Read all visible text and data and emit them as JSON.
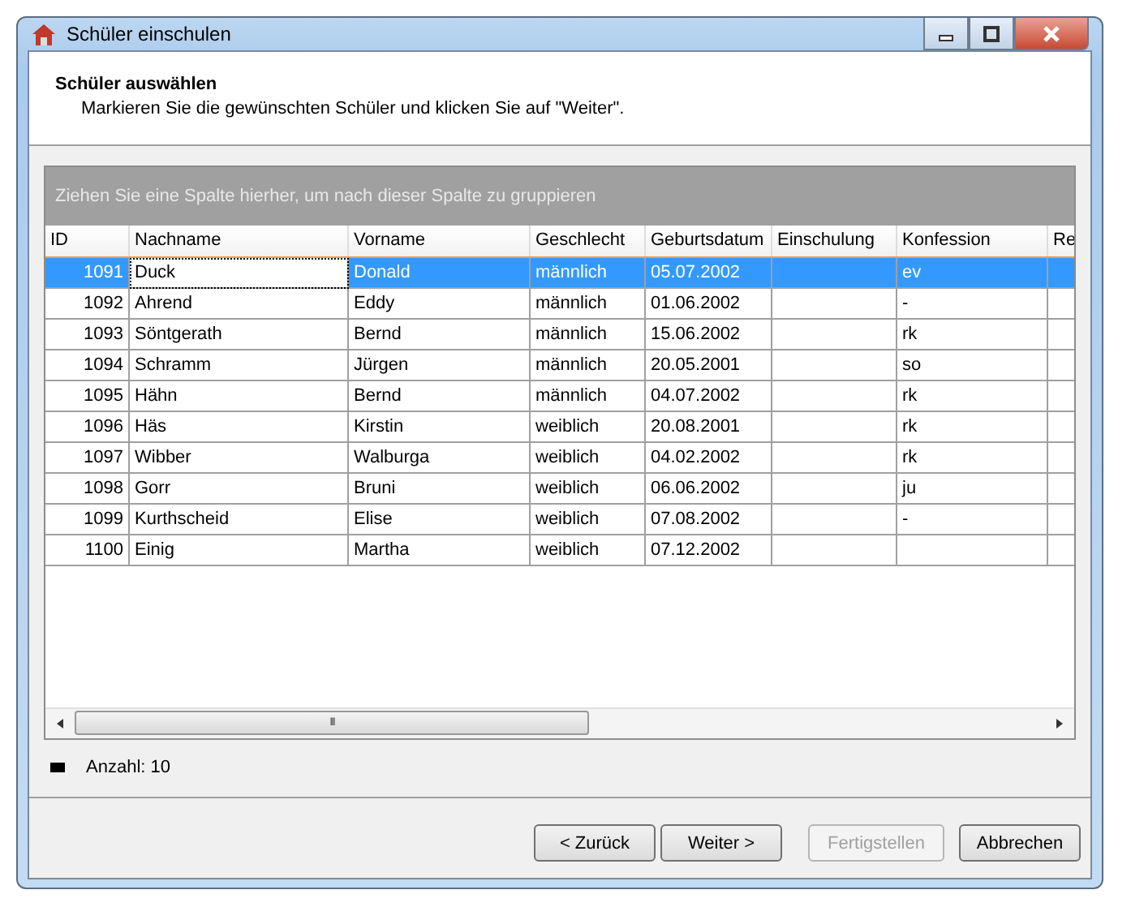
{
  "window": {
    "title": "Schüler einschulen"
  },
  "header": {
    "title": "Schüler auswählen",
    "subtitle": "Markieren Sie die gewünschten Schüler und klicken Sie auf \"Weiter\"."
  },
  "grid": {
    "group_hint": "Ziehen Sie eine Spalte hierher, um nach dieser Spalte zu gruppieren",
    "columns": [
      "ID",
      "Nachname",
      "Vorname",
      "Geschlecht",
      "Geburtsdatum",
      "Einschulung",
      "Konfession",
      "Re"
    ],
    "rows": [
      {
        "cells": [
          "1091",
          "Duck",
          "Donald",
          "männlich",
          "05.07.2002",
          null,
          "ev",
          null
        ],
        "selected": true
      },
      {
        "cells": [
          "1092",
          "Ahrend",
          "Eddy",
          "männlich",
          "01.06.2002",
          null,
          "-",
          null
        ],
        "selected": false
      },
      {
        "cells": [
          "1093",
          "Söntgerath",
          "Bernd",
          "männlich",
          "15.06.2002",
          null,
          "rk",
          null
        ],
        "selected": false
      },
      {
        "cells": [
          "1094",
          "Schramm",
          "Jürgen",
          "männlich",
          "20.05.2001",
          null,
          "so",
          null
        ],
        "selected": false
      },
      {
        "cells": [
          "1095",
          "Hähn",
          "Bernd",
          "männlich",
          "04.07.2002",
          null,
          "rk",
          null
        ],
        "selected": false
      },
      {
        "cells": [
          "1096",
          "Häs",
          "Kirstin",
          "weiblich",
          "20.08.2001",
          null,
          "rk",
          null
        ],
        "selected": false
      },
      {
        "cells": [
          "1097",
          "Wibber",
          "Walburga",
          "weiblich",
          "04.02.2002",
          null,
          "rk",
          null
        ],
        "selected": false
      },
      {
        "cells": [
          "1098",
          "Gorr",
          "Bruni",
          "weiblich",
          "06.06.2002",
          null,
          "ju",
          null
        ],
        "selected": false
      },
      {
        "cells": [
          "1099",
          "Kurthscheid",
          "Elise",
          "weiblich",
          "07.08.2002",
          null,
          "-",
          null
        ],
        "selected": false
      },
      {
        "cells": [
          "1100",
          "Einig",
          "Martha",
          "weiblich",
          "07.12.2002",
          null,
          null,
          null
        ],
        "selected": false
      }
    ],
    "scrollbar_grip": "III"
  },
  "count": "Anzahl: 10",
  "buttons": [
    {
      "label": "< Zurück",
      "disabled": false
    },
    {
      "label": "Weiter >",
      "disabled": false
    },
    {
      "label": "Fertigstellen",
      "disabled": true
    },
    {
      "label": "Abbrechen",
      "disabled": false
    }
  ]
}
